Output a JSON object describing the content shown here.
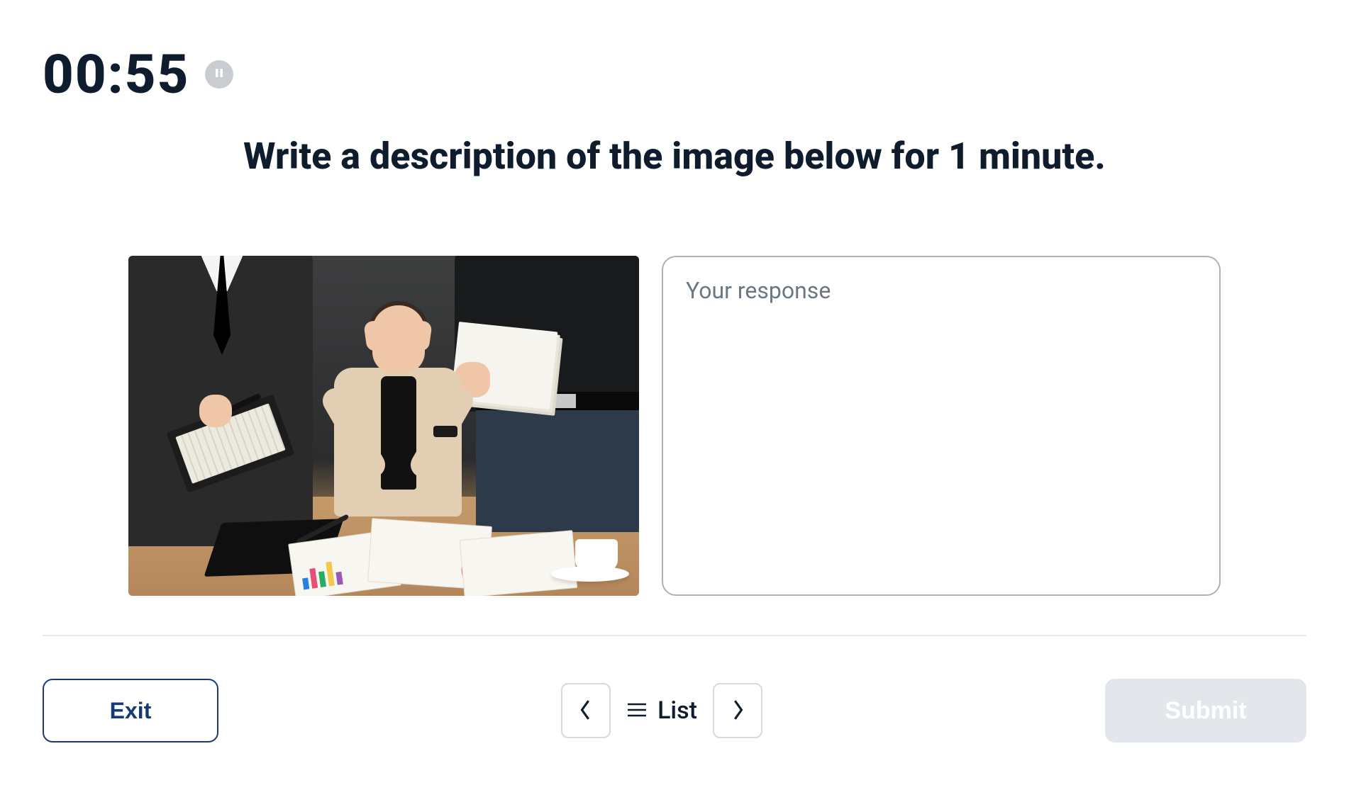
{
  "timer": {
    "value": "00:55"
  },
  "prompt": {
    "text": "Write a description of the image below for 1 minute."
  },
  "response": {
    "placeholder": "Your response",
    "value": ""
  },
  "footer": {
    "exit_label": "Exit",
    "list_label": "List",
    "submit_label": "Submit"
  },
  "image": {
    "alt": "A stressed woman seated at a desk with her hands on her temples while two standing male colleagues present documents and charts around her; printed charts, a notebook, and a coffee cup are on the wooden table."
  }
}
